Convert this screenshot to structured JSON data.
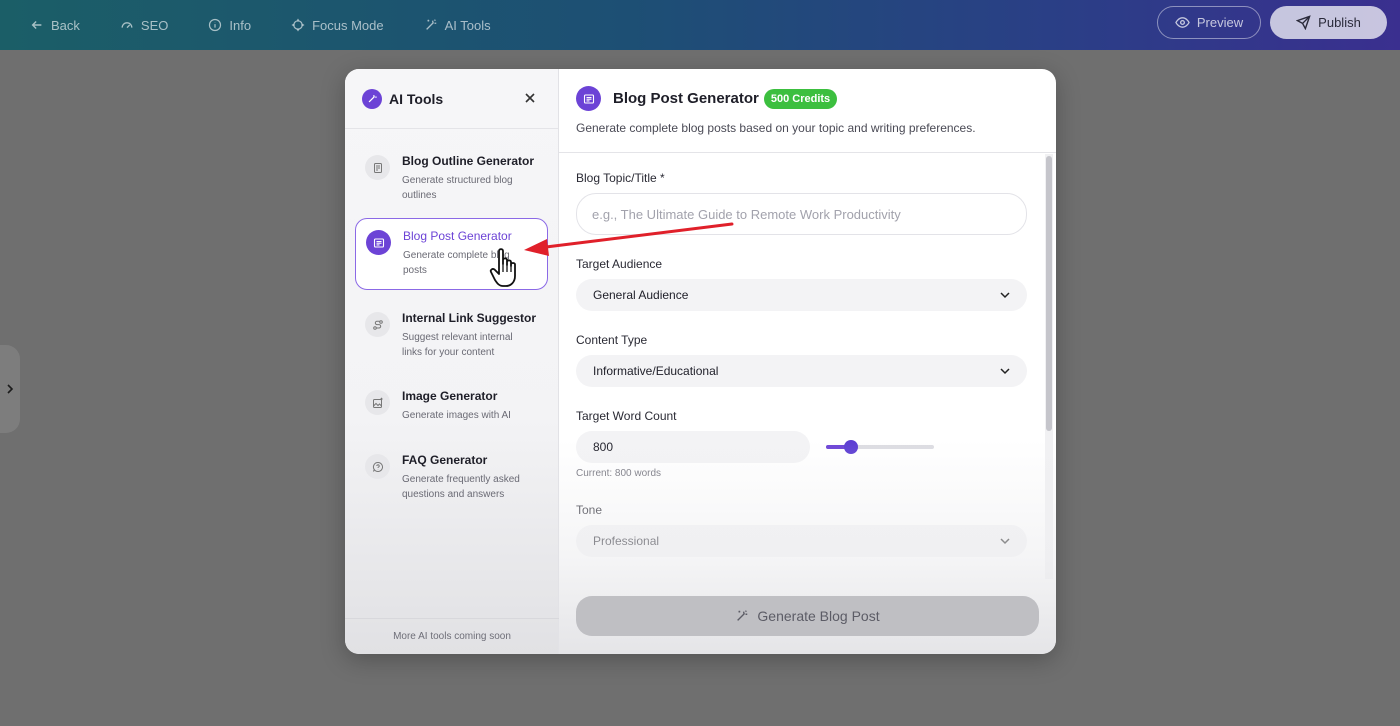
{
  "topbar": {
    "back_label": "Back",
    "seo_label": "SEO",
    "info_label": "Info",
    "focus_label": "Focus Mode",
    "aitools_label": "AI Tools",
    "preview_label": "Preview",
    "publish_label": "Publish"
  },
  "sidebar": {
    "title": "AI Tools",
    "footer": "More AI tools coming soon",
    "tools": [
      {
        "name": "Blog Outline Generator",
        "desc": "Generate structured blog outlines",
        "icon": "document-icon"
      },
      {
        "name": "Blog Post Generator",
        "desc": "Generate complete blog posts",
        "icon": "article-icon",
        "active": true
      },
      {
        "name": "Internal Link Suggestor",
        "desc": "Suggest relevant internal links for your content",
        "icon": "route-icon"
      },
      {
        "name": "Image Generator",
        "desc": "Generate images with AI",
        "icon": "image-sparkle-icon"
      },
      {
        "name": "FAQ Generator",
        "desc": "Generate frequently asked questions and answers",
        "icon": "question-icon"
      }
    ]
  },
  "main": {
    "title": "Blog Post Generator",
    "credits": "500 Credits",
    "subtitle": "Generate complete blog posts based on your topic and writing preferences.",
    "topic_label": "Blog Topic/Title *",
    "topic_placeholder": "e.g., The Ultimate Guide to Remote Work Productivity",
    "audience_label": "Target Audience",
    "audience_value": "General Audience",
    "content_type_label": "Content Type",
    "content_type_value": "Informative/Educational",
    "word_count_label": "Target Word Count",
    "word_count_value": "800",
    "word_count_helper": "Current: 800 words",
    "word_count_slider_fraction": 0.23,
    "tone_label": "Tone",
    "tone_value": "Professional",
    "generate_label": "Generate Blog Post"
  },
  "colors": {
    "accent": "#6c43d6",
    "credits_badge": "#3cbf3f",
    "annotation_arrow": "#e0202a"
  }
}
